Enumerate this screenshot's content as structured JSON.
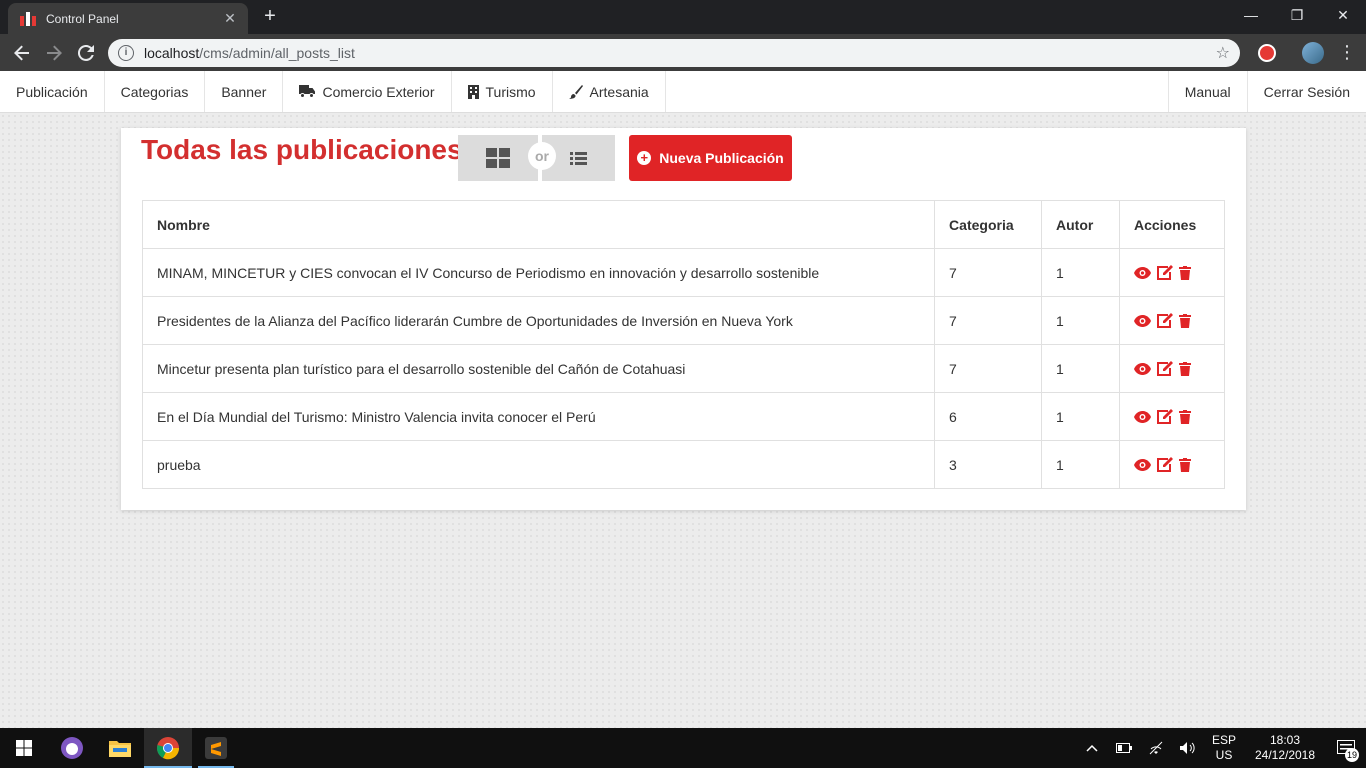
{
  "browser": {
    "tab_title": "Control Panel",
    "url_host": "localhost",
    "url_path": "/cms/admin/all_posts_list"
  },
  "navbar": {
    "items": [
      {
        "label": "Publicación",
        "icon": ""
      },
      {
        "label": "Categorias",
        "icon": ""
      },
      {
        "label": "Banner",
        "icon": ""
      },
      {
        "label": "Comercio Exterior",
        "icon": "truck-icon"
      },
      {
        "label": "Turismo",
        "icon": "building-icon"
      },
      {
        "label": "Artesania",
        "icon": "paintbrush-icon"
      }
    ],
    "right_items": [
      {
        "label": "Manual"
      },
      {
        "label": "Cerrar Sesión"
      }
    ]
  },
  "main": {
    "title": "Todas las publicaciones",
    "toggle_or": "or",
    "new_button": "Nueva Publicación",
    "accent_color": "#d32f2f"
  },
  "table": {
    "headers": {
      "name": "Nombre",
      "category": "Categoria",
      "author": "Autor",
      "actions": "Acciones"
    },
    "rows": [
      {
        "name": "MINAM, MINCETUR y CIES convocan el IV Concurso de Periodismo en innovación y desarrollo sostenible",
        "category": "7",
        "author": "1"
      },
      {
        "name": "Presidentes de la Alianza del Pacífico liderarán Cumbre de Oportunidades de Inversión en Nueva York",
        "category": "7",
        "author": "1"
      },
      {
        "name": "Mincetur presenta plan turístico para el desarrollo sostenible del Cañón de Cotahuasi",
        "category": "7",
        "author": "1"
      },
      {
        "name": "En el Día Mundial del Turismo: Ministro Valencia invita conocer el Perú",
        "category": "6",
        "author": "1"
      },
      {
        "name": "prueba",
        "category": "3",
        "author": "1"
      }
    ]
  },
  "taskbar": {
    "lang_line1": "ESP",
    "lang_line2": "US",
    "time": "18:03",
    "date": "24/12/2018",
    "notification_count": "19"
  }
}
